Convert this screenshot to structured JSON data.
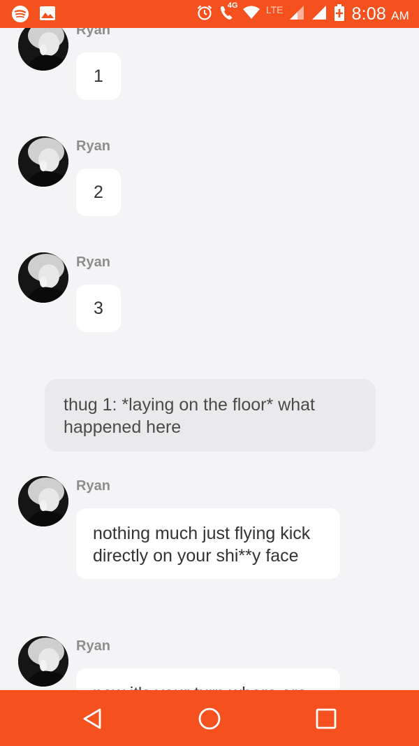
{
  "status_bar": {
    "time": "8:08",
    "ampm": "AM",
    "network_label": "4G",
    "lte_label": "LTE",
    "icons": [
      "spotify-icon",
      "gallery-icon",
      "alarm-icon",
      "volte-call-icon",
      "wifi-icon",
      "signal-icon",
      "signal-icon",
      "battery-charging-icon"
    ]
  },
  "colors": {
    "accent": "#f4511e",
    "background": "#f4f4f6",
    "bubble": "#ffffff",
    "narration": "#eaeaec"
  },
  "messages": [
    {
      "sender": "Ryan",
      "text": "1"
    },
    {
      "sender": "Ryan",
      "text": "2"
    },
    {
      "sender": "Ryan",
      "text": "3"
    },
    {
      "type": "narration",
      "text": "thug 1: *laying on the floor* what happened here"
    },
    {
      "sender": "Ryan",
      "text": "nothing much just flying kick directly on your shi**y face"
    },
    {
      "sender": "Ryan",
      "text": "now it's your turn where are"
    }
  ],
  "nav": {
    "buttons": [
      "back-icon",
      "home-icon",
      "recents-icon"
    ]
  }
}
